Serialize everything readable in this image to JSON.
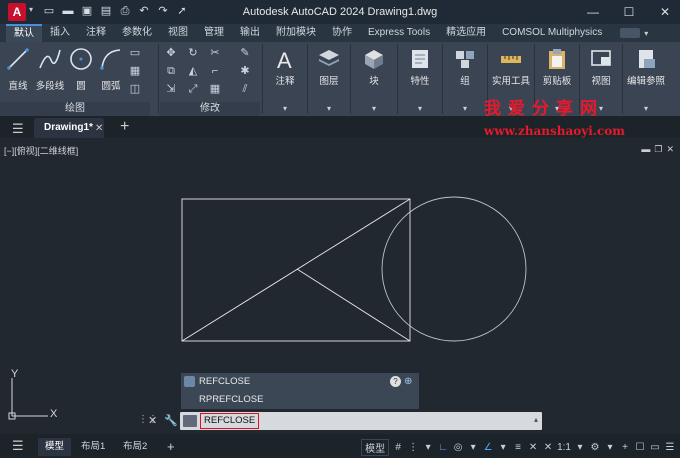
{
  "titlebar": {
    "app_logo": "A",
    "title": "Autodesk AutoCAD 2024   Drawing1.dwg",
    "qat_icons": [
      "new-icon",
      "open-icon",
      "save-icon",
      "saveas-icon",
      "print-icon",
      "undo-icon",
      "redo-icon",
      "share-icon"
    ]
  },
  "ribbon_tabs": [
    "默认",
    "插入",
    "注释",
    "参数化",
    "视图",
    "管理",
    "输出",
    "附加模块",
    "协作",
    "Express Tools",
    "精选应用",
    "COMSOL Multiphysics"
  ],
  "active_tab": "默认",
  "draw_panel": {
    "title": "绘图",
    "line": "直线",
    "polyline": "多段线",
    "circle": "圆",
    "arc": "圆弧"
  },
  "modify_panel": {
    "title": "修改"
  },
  "panels": [
    {
      "label": "注释",
      "icon": "annotation-icon"
    },
    {
      "label": "图层",
      "icon": "layers-icon"
    },
    {
      "label": "块",
      "icon": "block-icon"
    },
    {
      "label": "特性",
      "icon": "properties-icon"
    },
    {
      "label": "组",
      "icon": "group-icon"
    },
    {
      "label": "实用工具",
      "icon": "utilities-icon"
    },
    {
      "label": "剪贴板",
      "icon": "clipboard-icon"
    },
    {
      "label": "视图",
      "icon": "view-icon"
    },
    {
      "label": "编辑参照",
      "icon": "edit-reference-icon"
    }
  ],
  "watermark": {
    "chinese": "我爱分享网",
    "url": "www.zhanshaoyi.com"
  },
  "doc_tab": {
    "name": "Drawing1*"
  },
  "viewport": {
    "label": "[−][俯视][二维线框]"
  },
  "ucs": {
    "x_label": "X",
    "y_label": "Y"
  },
  "autocomplete": {
    "items": [
      "REFCLOSE",
      "RPREFCLOSE"
    ]
  },
  "command_line": {
    "value": "REFCLOSE"
  },
  "layout_tabs": [
    "模型",
    "布局1",
    "布局2"
  ],
  "status": {
    "model_label": "模型",
    "scale": "1:1"
  },
  "colors": {
    "accent": "#4a90d9",
    "highlight_border": "#e0111e",
    "watermark": "#e8192c"
  }
}
